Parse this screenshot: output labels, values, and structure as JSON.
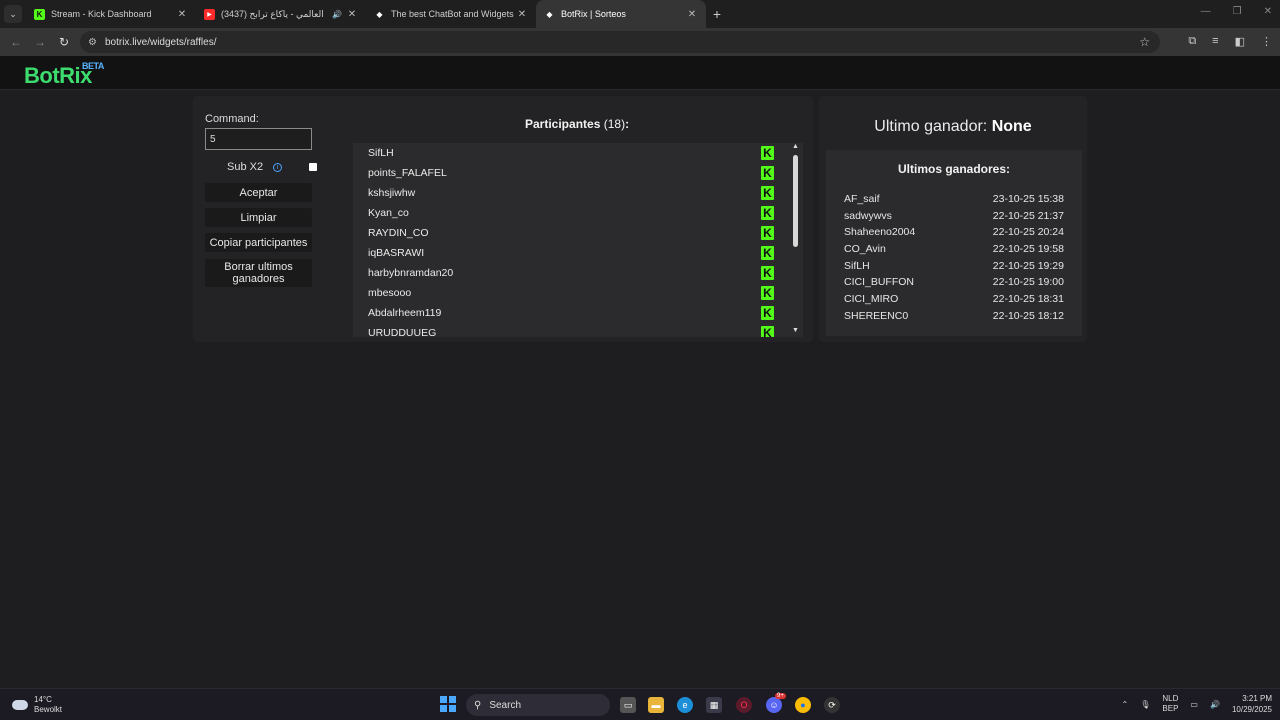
{
  "browser": {
    "tabs": [
      {
        "title": "Stream - Kick Dashboard",
        "favicon": "kick-icon"
      },
      {
        "title": "العالمي - ياكاع ترابح (3437)",
        "favicon": "youtube-icon"
      },
      {
        "title": "The best ChatBot and Widgets",
        "favicon": "botrix-icon"
      },
      {
        "title": "BotRix | Sorteos",
        "favicon": "botrix-icon"
      }
    ],
    "url": "botrix.live/widgets/raffles/"
  },
  "site": {
    "logo": "BotRix",
    "logo_badge": "BETA"
  },
  "raffle": {
    "command_label": "Command:",
    "command_value": "5",
    "sub_label": "Sub X2",
    "buttons": {
      "accept": "Aceptar",
      "clear": "Limpiar",
      "copy": "Copiar participantes",
      "delete_winners": "Borrar ultimos ganadores"
    },
    "participants_label": "Participantes",
    "participants_count": "(18)",
    "participants_colon": ":",
    "participants": [
      "SifLH",
      "points_FALAFEL",
      "kshsjiwhw",
      "Kyan_co",
      "RAYDIN_CO",
      "iqBASRAWI",
      "harbybnramdan20",
      "mbesooo",
      "Abdalrheem119",
      "URUDDUUEG"
    ]
  },
  "winners": {
    "last_winner_label": "Ultimo ganador:",
    "last_winner_value": "None",
    "title": "Ultimos ganadores:",
    "list": [
      {
        "name": "AF_saif",
        "date": "23-10-25 15:38"
      },
      {
        "name": "sadwywvs",
        "date": "22-10-25 21:37"
      },
      {
        "name": "Shaheeno2004",
        "date": "22-10-25 20:24"
      },
      {
        "name": "CO_Avin",
        "date": "22-10-25 19:58"
      },
      {
        "name": "SifLH",
        "date": "22-10-25 19:29"
      },
      {
        "name": "CICI_BUFFON",
        "date": "22-10-25 19:00"
      },
      {
        "name": "CICI_MIRO",
        "date": "22-10-25 18:31"
      },
      {
        "name": "SHEREENC0",
        "date": "22-10-25 18:12"
      }
    ]
  },
  "taskbar": {
    "temperature": "14°C",
    "weather": "Bewolkt",
    "search_placeholder": "Search",
    "lang_top": "NLD",
    "lang_bottom": "BEP",
    "time": "3:21 PM",
    "date": "10/29/2025",
    "discord_badge": "9+"
  },
  "colors": {
    "brand_green": "#3ddc6e",
    "kick_green": "#53fc18",
    "beta_blue": "#5ab4ff"
  }
}
